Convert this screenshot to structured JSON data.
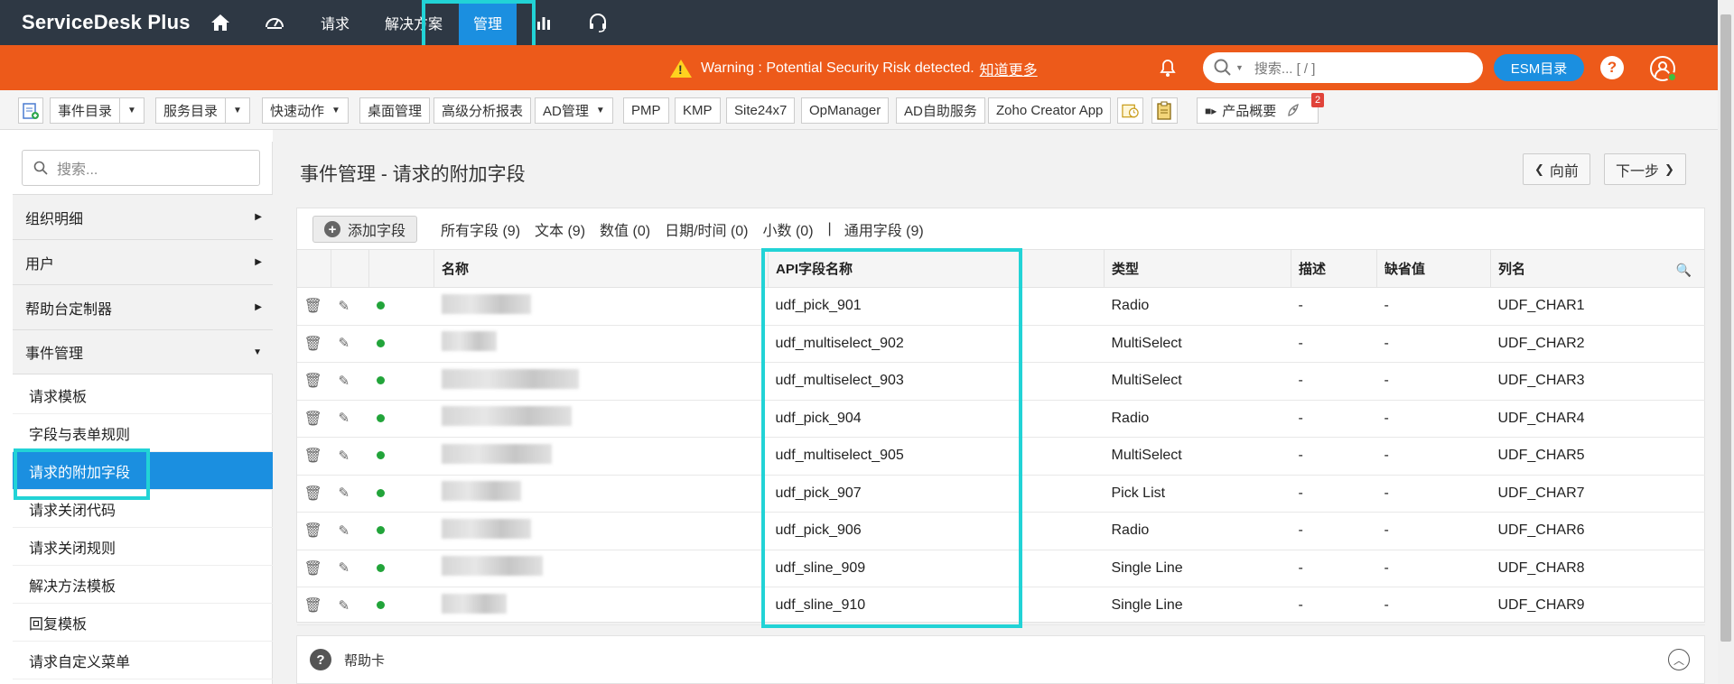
{
  "app": {
    "logo_text": "ServiceDesk Plus"
  },
  "nav": {
    "items": [
      {
        "label": "请求"
      },
      {
        "label": "解决方案"
      },
      {
        "label": "管理"
      }
    ]
  },
  "warning": {
    "text": "Warning : Potential Security Risk detected.",
    "link": "知道更多"
  },
  "header": {
    "search_placeholder": "搜索... [ / ]",
    "esm_label": "ESM目录",
    "help_label": "?"
  },
  "toolbar": {
    "event_catalog": "事件目录",
    "service_catalog": "服务目录",
    "quick_actions": "快速动作",
    "desktop_mgmt": "桌面管理",
    "advanced_reports": "高级分析报表",
    "ad_mgmt": "AD管理",
    "pmp": "PMP",
    "kmp": "KMP",
    "site24x7": "Site24x7",
    "opmanager": "OpManager",
    "ad_selfservice": "AD自助服务",
    "zoho_creator": "Zoho Creator App",
    "product_overview": "产品概要",
    "badge_count": "2"
  },
  "sidebar": {
    "search_placeholder": "搜索...",
    "groups": [
      {
        "label": "组织明细"
      },
      {
        "label": "用户"
      },
      {
        "label": "帮助台定制器"
      },
      {
        "label": "事件管理"
      }
    ],
    "items": [
      {
        "label": "请求模板"
      },
      {
        "label": "字段与表单规则"
      },
      {
        "label": "请求的附加字段"
      },
      {
        "label": "请求关闭代码"
      },
      {
        "label": "请求关闭规则"
      },
      {
        "label": "解决方法模板"
      },
      {
        "label": "回复模板"
      },
      {
        "label": "请求自定义菜单"
      }
    ]
  },
  "main": {
    "title": "事件管理 - 请求的附加字段",
    "prev_label": "向前",
    "next_label": "下一步",
    "add_field_label": "添加字段",
    "filters": [
      "所有字段 (9)",
      "文本 (9)",
      "数值 (0)",
      "日期/时间 (0)",
      "小数 (0)",
      "|",
      "通用字段 (9)"
    ],
    "columns": [
      "名称",
      "API字段名称",
      "类型",
      "描述",
      "缺省值",
      "列名"
    ],
    "rows": [
      {
        "api": "udf_pick_901",
        "type": "Radio",
        "desc": "-",
        "default": "-",
        "column": "UDF_CHAR1",
        "blur": 0.62
      },
      {
        "api": "udf_multiselect_902",
        "type": "MultiSelect",
        "desc": "-",
        "default": "-",
        "column": "UDF_CHAR2",
        "blur": 0.38
      },
      {
        "api": "udf_multiselect_903",
        "type": "MultiSelect",
        "desc": "-",
        "default": "-",
        "column": "UDF_CHAR3",
        "blur": 0.95
      },
      {
        "api": "udf_pick_904",
        "type": "Radio",
        "desc": "-",
        "default": "-",
        "column": "UDF_CHAR4",
        "blur": 0.9
      },
      {
        "api": "udf_multiselect_905",
        "type": "MultiSelect",
        "desc": "-",
        "default": "-",
        "column": "UDF_CHAR5",
        "blur": 0.76
      },
      {
        "api": "udf_pick_907",
        "type": "Pick List",
        "desc": "-",
        "default": "-",
        "column": "UDF_CHAR7",
        "blur": 0.55
      },
      {
        "api": "udf_pick_906",
        "type": "Radio",
        "desc": "-",
        "default": "-",
        "column": "UDF_CHAR6",
        "blur": 0.62
      },
      {
        "api": "udf_sline_909",
        "type": "Single Line",
        "desc": "-",
        "default": "-",
        "column": "UDF_CHAR8",
        "blur": 0.7
      },
      {
        "api": "udf_sline_910",
        "type": "Single Line",
        "desc": "-",
        "default": "-",
        "column": "UDF_CHAR9",
        "blur": 0.45
      }
    ]
  },
  "help_card": {
    "label": "帮助卡"
  },
  "colors": {
    "nav_bg": "#2e3844",
    "warning_bg": "#ed5a1a",
    "accent": "#1b8fe0",
    "highlight": "#22d3d6",
    "status_active": "#22a43a"
  },
  "icons": [
    "home-icon",
    "dashboard-icon",
    "chart-icon",
    "headset-icon",
    "warning-icon",
    "bell-icon",
    "search-icon",
    "help-icon",
    "user-icon",
    "trash-icon",
    "edit-icon",
    "status-dot-icon",
    "magnifier-icon",
    "rocket-icon",
    "collapse-icon"
  ]
}
